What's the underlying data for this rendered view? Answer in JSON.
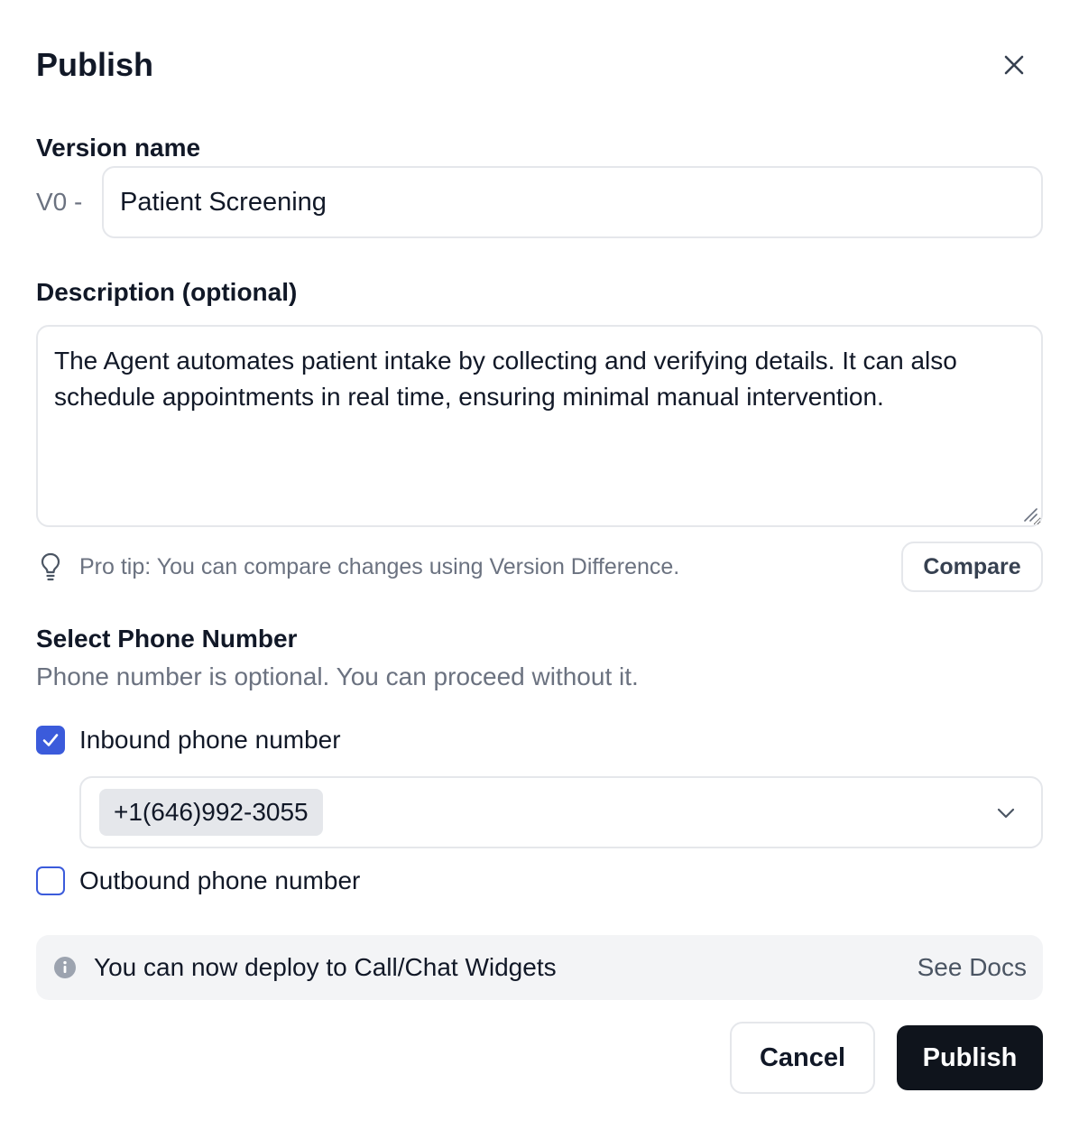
{
  "dialog": {
    "title": "Publish",
    "close_icon": "close-icon"
  },
  "version": {
    "label": "Version name",
    "prefix": "V0 -",
    "value": "Patient Screening"
  },
  "description": {
    "label": "Description (optional)",
    "value": "The Agent automates patient intake by collecting and verifying details. It can also schedule appointments in real time, ensuring minimal manual intervention."
  },
  "tip": {
    "icon": "lightbulb-icon",
    "text": "Pro tip: You can compare changes using Version Difference.",
    "compare_label": "Compare"
  },
  "phone": {
    "section_title": "Select Phone Number",
    "subtitle": "Phone number is optional. You can proceed without it.",
    "inbound": {
      "label": "Inbound phone number",
      "checked": true,
      "selected_number": "+1(646)992-3055"
    },
    "outbound": {
      "label": "Outbound phone number",
      "checked": false
    }
  },
  "banner": {
    "icon": "info-icon",
    "text": "You can now deploy to Call/Chat Widgets",
    "link_label": "See Docs"
  },
  "footer": {
    "cancel_label": "Cancel",
    "publish_label": "Publish"
  },
  "colors": {
    "accent": "#3b5bdb",
    "primary_button": "#0f141c",
    "banner_bg": "#f3f4f6",
    "border": "#e5e7eb"
  }
}
